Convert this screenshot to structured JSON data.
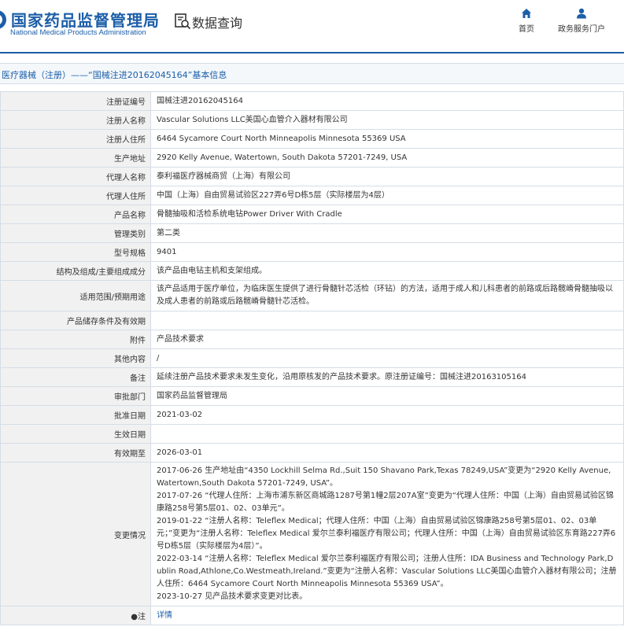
{
  "header": {
    "logo_cn": "国家药品监督管理局",
    "logo_en": "National Medical Products Administration",
    "query_title": "数据查询",
    "nav": [
      {
        "label": "首页",
        "icon": "home-icon"
      },
      {
        "label": "政务服务门户",
        "icon": "user-icon"
      }
    ]
  },
  "breadcrumb": "医疗器械（注册）——“国械注进20162045164”基本信息",
  "rows": [
    {
      "label": "注册证编号",
      "value": "国械注进20162045164"
    },
    {
      "label": "注册人名称",
      "value": "Vascular Solutions LLC美国心血管介入器材有限公司"
    },
    {
      "label": "注册人住所",
      "value": "6464 Sycamore Court North Minneapolis Minnesota 55369 USA"
    },
    {
      "label": "生产地址",
      "value": "2920 Kelly Avenue, Watertown, South Dakota 57201-7249, USA"
    },
    {
      "label": "代理人名称",
      "value": "泰利福医疗器械商贸（上海）有限公司"
    },
    {
      "label": "代理人住所",
      "value": "中国（上海）自由贸易试验区227弄6号D栋5层（实际楼层为4层）"
    },
    {
      "label": "产品名称",
      "value": "骨髓抽吸和活检系统电钻Power Driver With Cradle"
    },
    {
      "label": "管理类别",
      "value": "第二类"
    },
    {
      "label": "型号规格",
      "value": "9401"
    },
    {
      "label": "结构及组成/主要组成成分",
      "value": "该产品由电钻主机和支架组成。"
    },
    {
      "label": "适用范围/预期用途",
      "value": "该产品适用于医疗单位，为临床医生提供了进行骨髓针芯活检（环钻）的方法，适用于成人和儿科患者的前路或后路髋嵴骨髓抽吸以及成人患者的前路或后路髋嵴骨髓针芯活检。"
    },
    {
      "label": "产品储存条件及有效期",
      "value": ""
    },
    {
      "label": "附件",
      "value": "产品技术要求"
    },
    {
      "label": "其他内容",
      "value": "/"
    },
    {
      "label": "备注",
      "value": "延续注册产品技术要求未发生变化，沿用原核发的产品技术要求。原注册证编号：国械注进20163105164"
    },
    {
      "label": "审批部门",
      "value": "国家药品监督管理局"
    },
    {
      "label": "批准日期",
      "value": "2021-03-02"
    },
    {
      "label": "生效日期",
      "value": ""
    },
    {
      "label": "有效期至",
      "value": "2026-03-01"
    }
  ],
  "changes": {
    "label": "变更情况",
    "entries": [
      "2017-06-26 生产地址由“4350 Lockhill Selma Rd.,Suit 150 Shavano Park,Texas 78249,USA”变更为“2920 Kelly Avenue,Watertown,South Dakota 57201-7249, USA”。",
      "2017-07-26 “代理人住所：上海市浦东新区商城路1287号第1幢2层207A室”变更为“代理人住所：中国（上海）自由贸易试验区锦康路258号第5层01、02、03单元”。",
      "2019-01-22 “注册人名称：Teleflex Medical；代理人住所：中国（上海）自由贸易试验区锦康路258号第5层01、02、03单元；”变更为“注册人名称：Teleflex Medical 爱尔兰泰利福医疗有限公司；代理人住所：中国（上海）自由贸易试验区东育路227弄6号D栋5层（实际楼层为4层）”。",
      "2022-03-14 “注册人名称：Teleflex Medical 爱尔兰泰利福医疗有限公司；注册人住所：IDA Business and Technology Park,Dublin Road,Athlone,Co.Westmeath,Ireland.”变更为“注册人名称：Vascular Solutions LLC美国心血管介入器材有限公司；注册人住所：6464 Sycamore Court North Minneapolis Minnesota 55369 USA”。",
      "2023-10-27 见产品技术要求变更对比表。"
    ]
  },
  "note_row": {
    "label": "●注",
    "link": "详情"
  }
}
